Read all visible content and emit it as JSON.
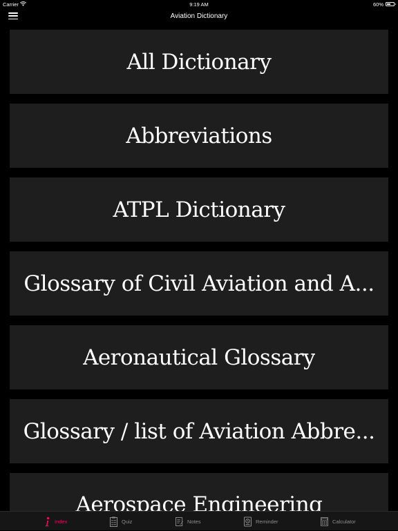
{
  "status_bar": {
    "carrier": "Carrier",
    "time": "9:19 AM",
    "battery": "60%",
    "battery_level": 0.6
  },
  "nav": {
    "title": "Aviation Dictionary"
  },
  "list": {
    "items": [
      {
        "label": "All Dictionary"
      },
      {
        "label": "Abbreviations"
      },
      {
        "label": "ATPL Dictionary"
      },
      {
        "label": "Glossary of Civil Aviation and A..."
      },
      {
        "label": "Aeronautical Glossary"
      },
      {
        "label": "Glossary / list of Aviation Abbre..."
      },
      {
        "label": "Aerospace Engineering"
      }
    ]
  },
  "tabbar": {
    "tabs": [
      {
        "label": "Index",
        "icon": "info-icon",
        "active": true
      },
      {
        "label": "Quiz",
        "icon": "clipboard-icon"
      },
      {
        "label": "Notes",
        "icon": "notes-icon"
      },
      {
        "label": "Reminder",
        "icon": "reminder-icon"
      },
      {
        "label": "Calculator",
        "icon": "calculator-icon"
      }
    ],
    "active_color": "#d4145a"
  }
}
